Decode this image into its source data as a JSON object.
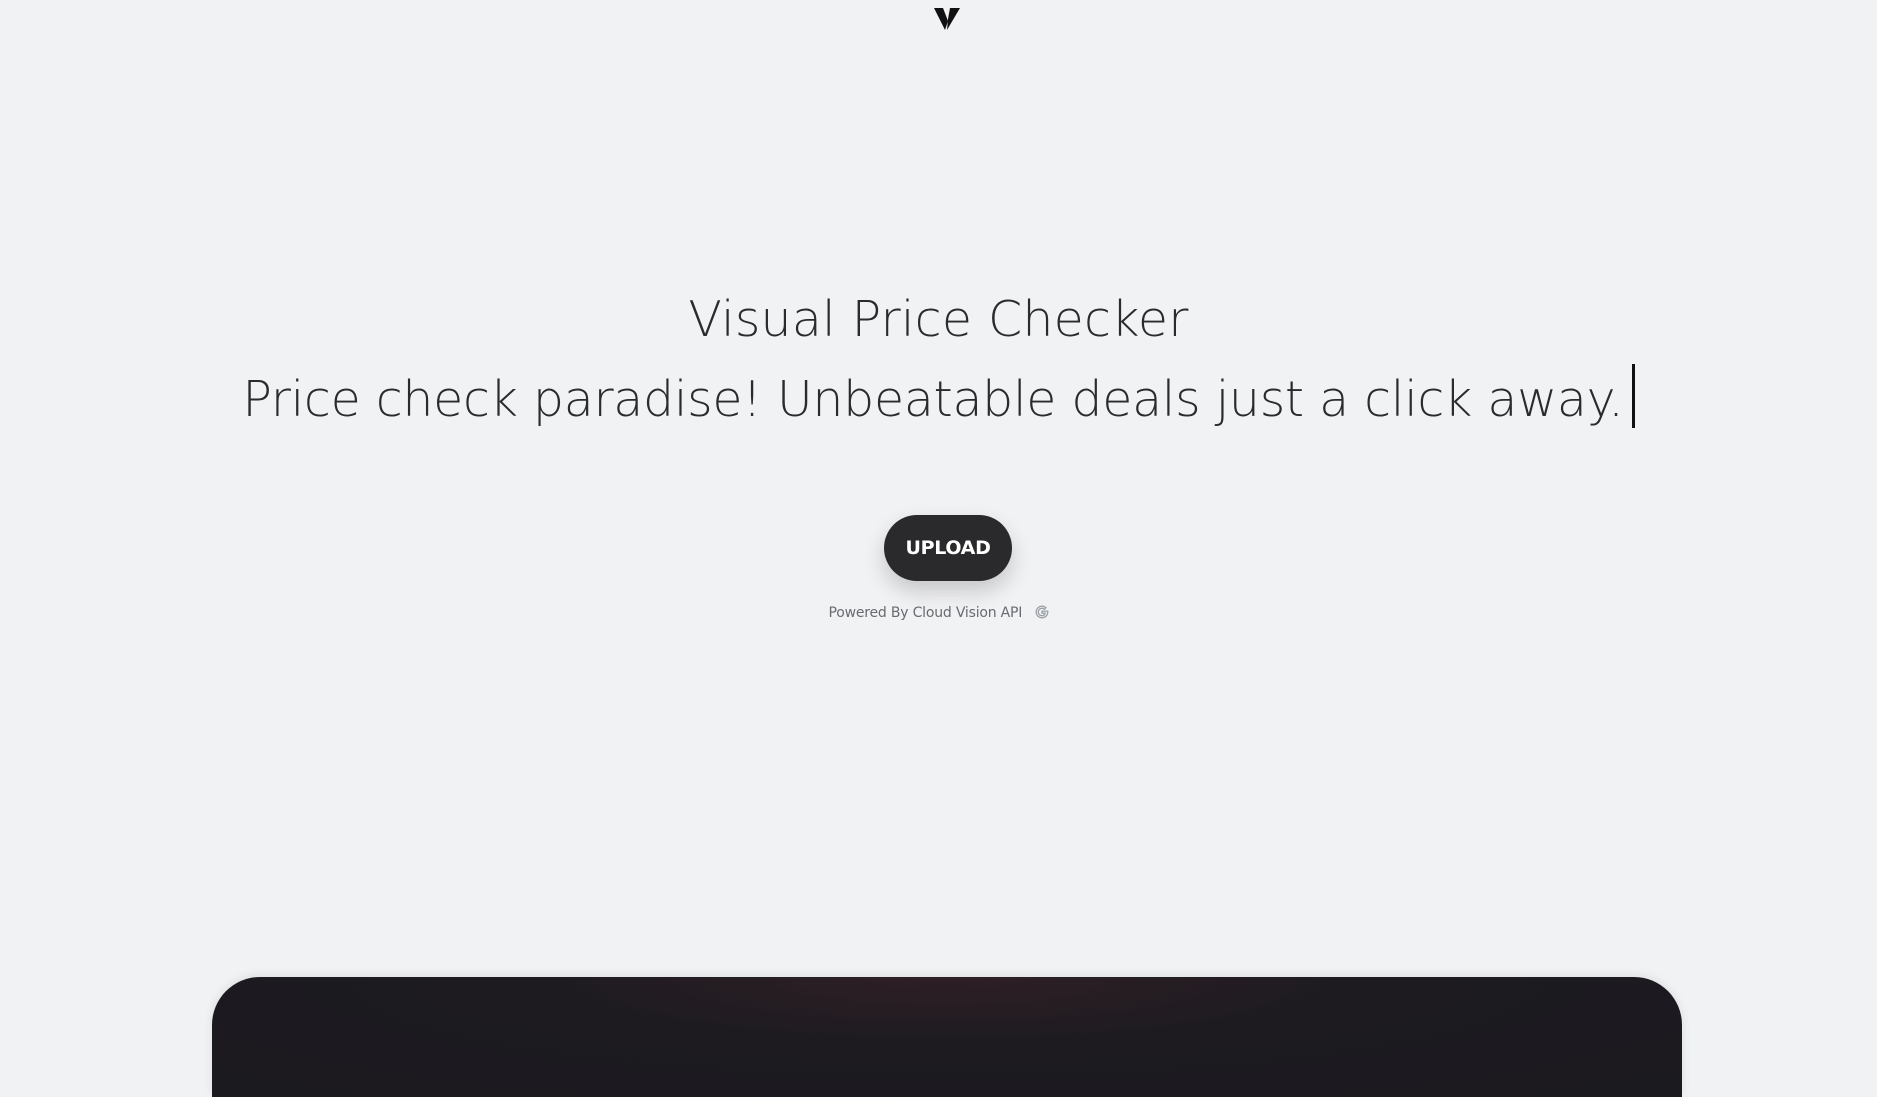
{
  "brand": {
    "logo_icon": "v-logo-icon"
  },
  "hero": {
    "title": "Visual Price Checker",
    "tagline": "Price check paradise! Unbeatable deals just a click away."
  },
  "actions": {
    "upload_label": "UPLOAD"
  },
  "footer_note": {
    "powered_by": "Powered By Cloud Vision API",
    "provider_icon": "google-g-icon"
  },
  "colors": {
    "background": "#f1f2f4",
    "text": "#2b2b2f",
    "button": "#2a2a2c",
    "preview_panel": "#1d1b20"
  }
}
